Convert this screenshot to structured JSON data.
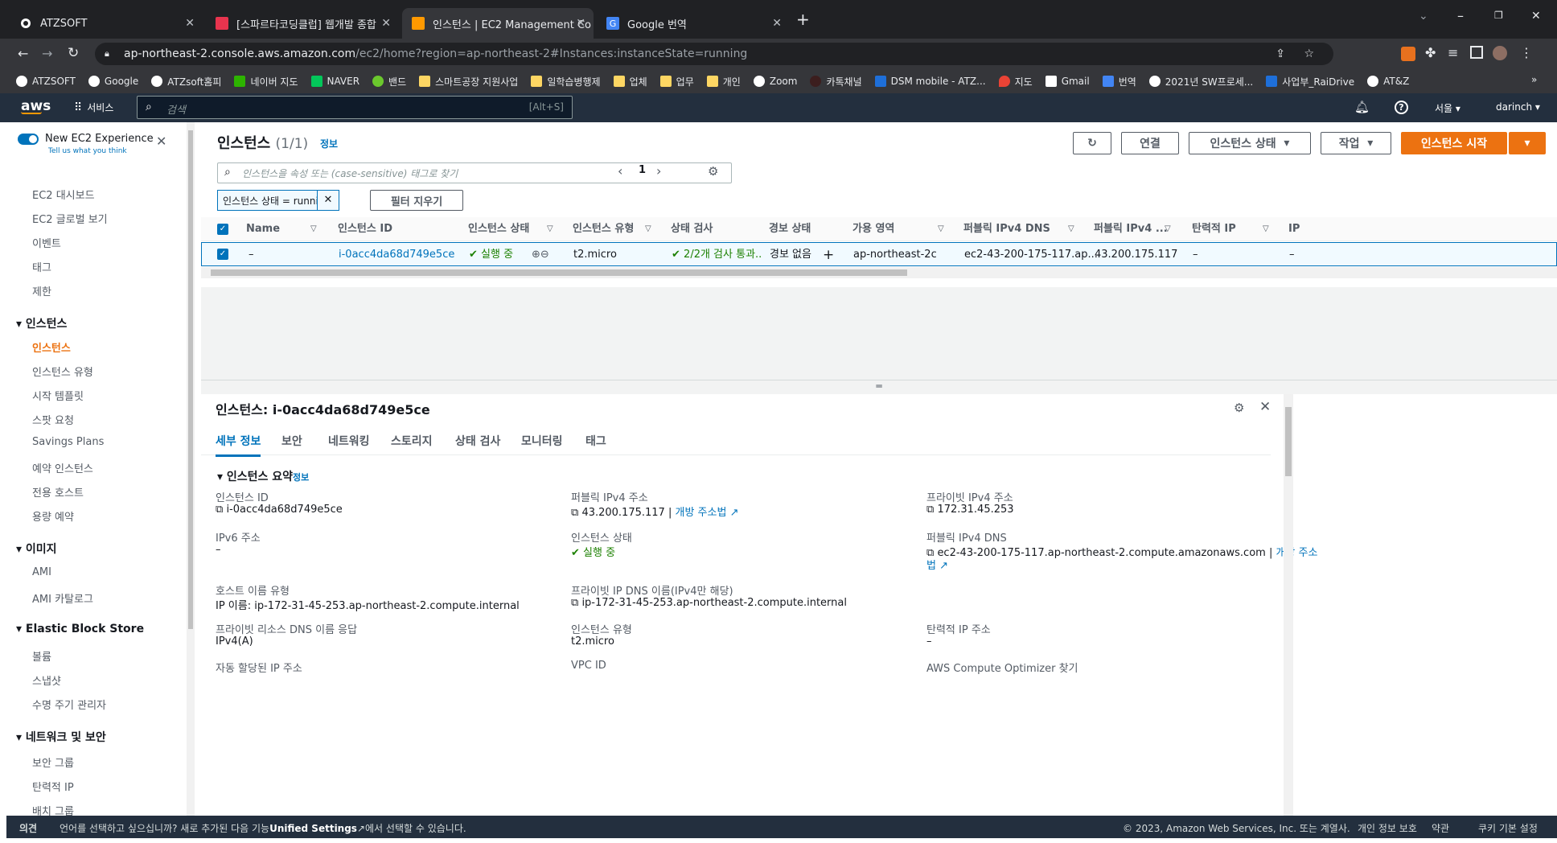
{
  "browser": {
    "tabs": [
      {
        "title": "ATZSOFT"
      },
      {
        "title": "[스파르타코딩클럽] 웹개발 종합"
      },
      {
        "title": "인스턴스 | EC2 Management Co"
      },
      {
        "title": "Google 번역"
      }
    ],
    "url_host": "ap-northeast-2.console.aws.amazon.com",
    "url_path": "/ec2/home?region=ap-northeast-2#Instances:instanceState=running",
    "bookmarks": [
      "ATZSOFT",
      "Google",
      "ATZsoft홈피",
      "네이버 지도",
      "NAVER",
      "밴드",
      "스마트공장 지원사업",
      "일학습병행제",
      "업체",
      "업무",
      "개인",
      "Zoom",
      "카톡채널",
      "DSM mobile - ATZ...",
      "지도",
      "Gmail",
      "번역",
      "2021년 SW프로세...",
      "사업부_RaiDrive",
      "AT&Z"
    ]
  },
  "aws": {
    "logo": "aws",
    "services": "서비스",
    "search_placeholder": "검색",
    "search_shortcut": "[Alt+S]",
    "region": "서울",
    "user": "darinch"
  },
  "sidebar": {
    "toggle_label": "New EC2 Experience",
    "toggle_sub": "Tell us what you think",
    "top_items": [
      "EC2 대시보드",
      "EC2 글로벌 보기",
      "이벤트",
      "태그",
      "제한"
    ],
    "sections": [
      {
        "title": "인스턴스",
        "items": [
          "인스턴스",
          "인스턴스 유형",
          "시작 템플릿",
          "스팟 요청",
          "Savings Plans",
          "예약 인스턴스",
          "전용 호스트",
          "용량 예약"
        ]
      },
      {
        "title": "이미지",
        "items": [
          "AMI",
          "AMI 카탈로그"
        ]
      },
      {
        "title": "Elastic Block Store",
        "items": [
          "볼륨",
          "스냅샷",
          "수명 주기 관리자"
        ]
      },
      {
        "title": "네트워크 및 보안",
        "items": [
          "보안 그룹",
          "탄력적 IP",
          "배치 그룹"
        ]
      }
    ]
  },
  "instances": {
    "title": "인스턴스",
    "count": "(1/1)",
    "info": "정보",
    "buttons": {
      "connect": "연결",
      "state": "인스턴스 상태",
      "actions": "작업",
      "launch": "인스턴스 시작"
    },
    "search_placeholder": "인스턴스을 속성 또는 (case-sensitive) 태그로 찾기",
    "filter_token": "인스턴스 상태 = running",
    "clear_filters": "필터 지우기",
    "page": "1",
    "columns": [
      "Name",
      "인스턴스 ID",
      "인스턴스 상태",
      "인스턴스 유형",
      "상태 검사",
      "경보 상태",
      "가용 영역",
      "퍼블릭 IPv4 DNS",
      "퍼블릭 IPv4 ...",
      "탄력적 IP",
      "IP"
    ],
    "row": {
      "name": "–",
      "id": "i-0acc4da68d749e5ce",
      "state": "실행 중",
      "type": "t2.micro",
      "check": "2/2개 검사 통과...",
      "alarm": "경보 없음",
      "az": "ap-northeast-2c",
      "dns": "ec2-43-200-175-117.ap...",
      "ipv4": "43.200.175.117",
      "eip": "–",
      "ip": "–"
    }
  },
  "detail": {
    "title": "인스턴스: i-0acc4da68d749e5ce",
    "tabs": [
      "세부 정보",
      "보안",
      "네트워킹",
      "스토리지",
      "상태 검사",
      "모니터링",
      "태그"
    ],
    "summary_title": "인스턴스 요약",
    "summary_info": "정보",
    "fields": {
      "instance_id_label": "인스턴스 ID",
      "instance_id": "i-0acc4da68d749e5ce",
      "public_ipv4_label": "퍼블릭 IPv4 주소",
      "public_ipv4": "43.200.175.117",
      "open_address": "개방 주소법",
      "private_ipv4_label": "프라이빗 IPv4 주소",
      "private_ipv4": "172.31.45.253",
      "ipv6_label": "IPv6 주소",
      "ipv6": "–",
      "state_label": "인스턴스 상태",
      "state": "실행 중",
      "public_dns_label": "퍼블릭 IPv4 DNS",
      "public_dns": "ec2-43-200-175-117.ap-northeast-2.compute.amazonaws.com",
      "open_address_2": "개방 주소",
      "open_address_3": "법",
      "hostname_type_label": "호스트 이름 유형",
      "hostname_type": "IP 이름: ip-172-31-45-253.ap-northeast-2.compute.internal",
      "private_dns_label": "프라이빗 IP DNS 이름(IPv4만 해당)",
      "private_dns": "ip-172-31-45-253.ap-northeast-2.compute.internal",
      "eip_label": "탄력적 IP 주소",
      "eip": "–",
      "resource_dns_label": "프라이빗 리소스 DNS 이름 응답",
      "resource_dns": "IPv4(A)",
      "type_label": "인스턴스 유형",
      "type": "t2.micro",
      "auto_ip_label": "자동 할당된 IP 주소",
      "vpc_label": "VPC ID",
      "optimizer_label": "AWS Compute Optimizer 찾기"
    }
  },
  "footer": {
    "feedback": "의견",
    "lang_pre": "언어를 선택하고 싶으십니까? 새로 추가된 다음 기능",
    "lang_link": "Unified Settings",
    "lang_post": "에서 선택할 수 있습니다.",
    "copyright": "© 2023, Amazon Web Services, Inc. 또는 계열사.",
    "privacy": "개인 정보 보호",
    "terms": "약관",
    "cookies": "쿠키 기본 설정"
  },
  "colors": {
    "accent": "#ec7211",
    "link": "#0073bb",
    "success": "#1d8102",
    "aws_nav": "#232f3e"
  }
}
